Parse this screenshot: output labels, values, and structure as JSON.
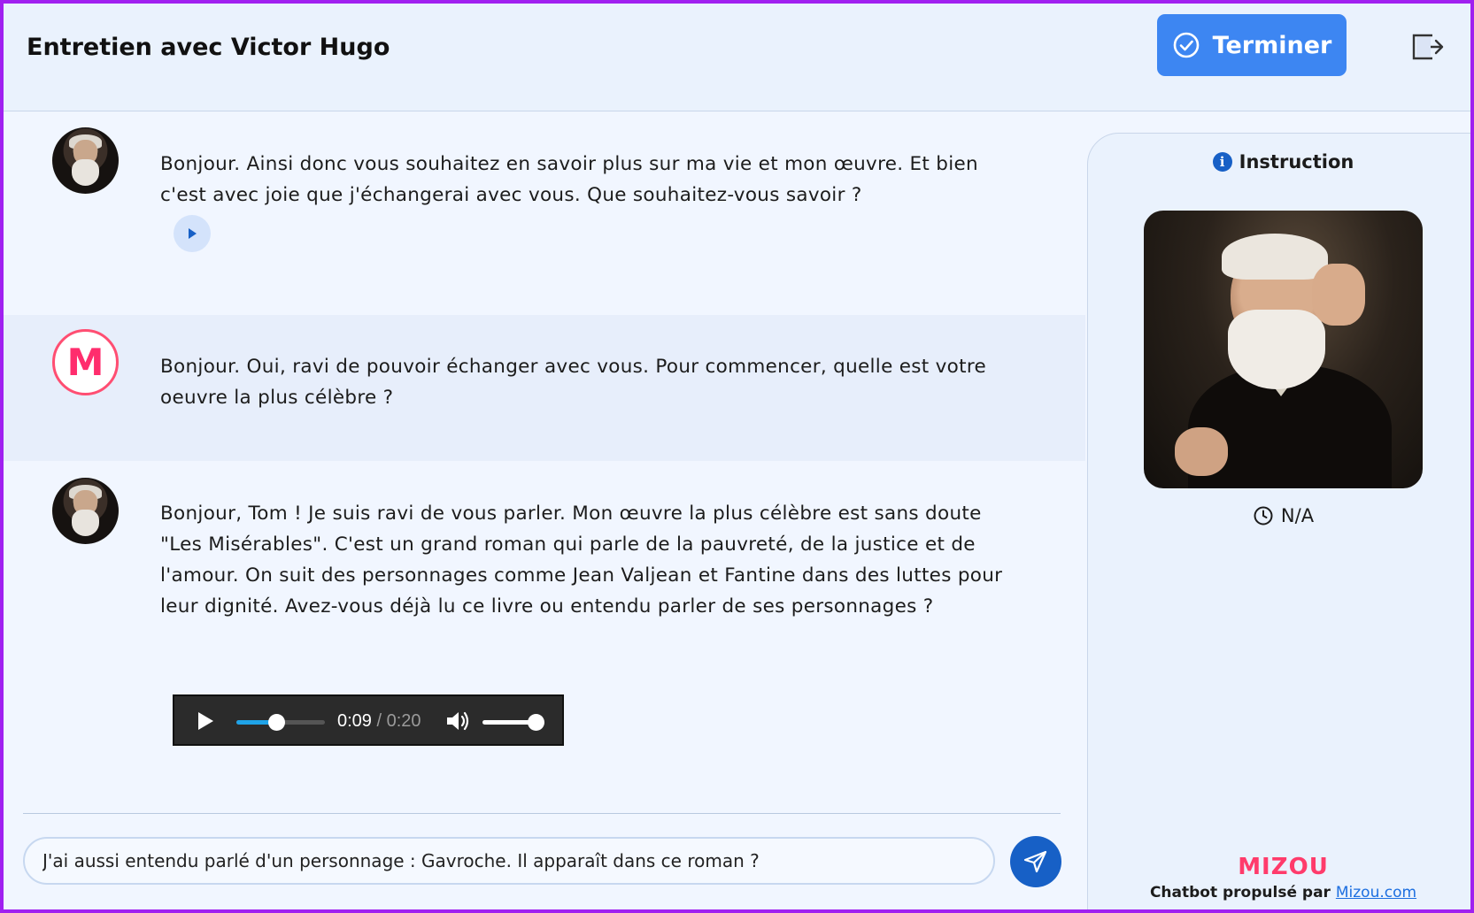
{
  "header": {
    "title": "Entretien avec Victor Hugo",
    "finish_label": "Terminer",
    "finish_icon": "check-circle-icon",
    "logout_icon": "logout-icon",
    "accent_color": "#3d86f2"
  },
  "messages": [
    {
      "role": "bot",
      "avatar": "victor-hugo-avatar",
      "text": "Bonjour. Ainsi donc vous souhaitez en savoir plus sur ma vie et mon œuvre. Et bien c'est avec joie que j'échangerai avec vous. Que souhaitez-vous savoir ?",
      "audio_mini": true
    },
    {
      "role": "user",
      "avatar": "M",
      "text": "Bonjour. Oui, ravi de pouvoir échanger avec vous. Pour commencer, quelle est votre oeuvre la plus célèbre ?"
    },
    {
      "role": "bot",
      "avatar": "victor-hugo-avatar",
      "text": "Bonjour, Tom ! Je suis ravi de vous parler. Mon œuvre la plus célèbre est sans doute \"Les Misérables\". C'est un grand roman qui parle de la pauvreté, de la justice et de l'amour. On suit des personnages comme Jean Valjean et Fantine dans des luttes pour leur dignité. Avez-vous déjà lu ce livre ou entendu parler de ses personnages ?",
      "audio_player": {
        "current": "0:09",
        "separator": " / ",
        "duration": "0:20",
        "progress_fraction": 0.45,
        "volume_fraction": 0.85
      }
    }
  ],
  "composer": {
    "value": "J'ai aussi entendu parlé d'un personnage : Gavroche. Il apparaît dans ce roman ?",
    "send_icon": "send-icon"
  },
  "sidebar": {
    "heading": "Instruction",
    "heading_icon": "info-icon",
    "timer_icon": "clock-icon",
    "timer_value": "N/A",
    "brand": "MIZOU",
    "powered_prefix": "Chatbot propulsé par",
    "powered_link": "Mizou.com"
  }
}
